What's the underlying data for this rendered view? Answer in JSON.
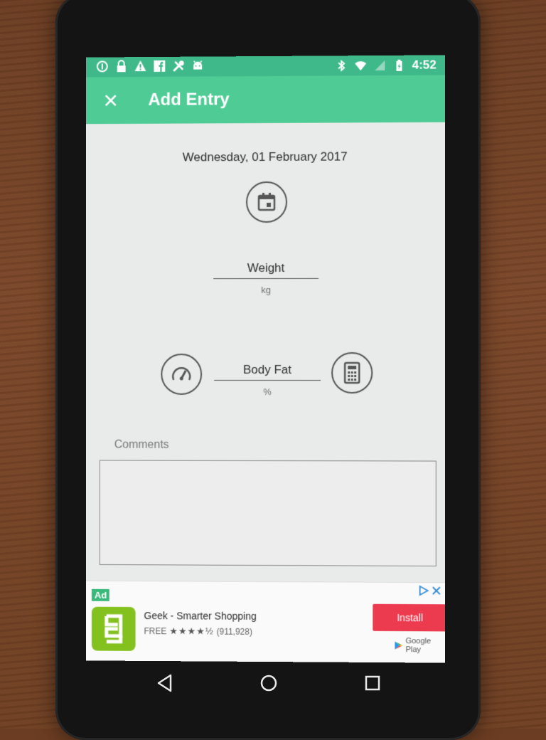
{
  "status_bar": {
    "time": "4:52",
    "left_icons": [
      "info-icon",
      "lock-icon",
      "warning-icon",
      "facebook-icon",
      "tools-icon",
      "android-icon"
    ],
    "right_icons": [
      "bluetooth-icon",
      "wifi-icon",
      "signal-icon",
      "battery-icon"
    ]
  },
  "app_bar": {
    "title": "Add Entry",
    "background": "#4fcb95",
    "status_background": "#3fb98a"
  },
  "entry": {
    "date": "Wednesday, 01 February 2017",
    "weight_label": "Weight",
    "weight_unit": "kg",
    "body_fat_label": "Body Fat",
    "body_fat_unit": "%",
    "comments_label": "Comments",
    "comments_value": ""
  },
  "ad": {
    "badge": "Ad",
    "app_name": "Geek - Smarter Shopping",
    "price": "FREE",
    "stars": "★★★★½",
    "rating_count": "(911,928)",
    "install_label": "Install",
    "store_label": "Google Play",
    "install_color": "#ec3a4f",
    "icon_color": "#82c11e"
  },
  "nav": {
    "icons": [
      "back-icon",
      "home-icon",
      "recents-icon"
    ]
  }
}
